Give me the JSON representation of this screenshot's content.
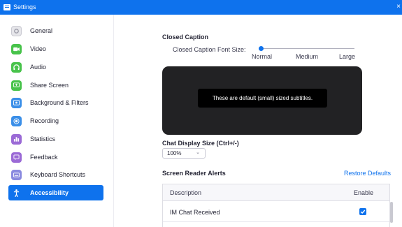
{
  "window": {
    "title": "Settings",
    "close": "×"
  },
  "sidebar": {
    "items": [
      {
        "label": "General",
        "icon": "gear-icon",
        "color": "#e6e6ea"
      },
      {
        "label": "Video",
        "icon": "video-icon",
        "color": "#48c34b"
      },
      {
        "label": "Audio",
        "icon": "headphones-icon",
        "color": "#48c34b"
      },
      {
        "label": "Share Screen",
        "icon": "share-screen-icon",
        "color": "#48c34b"
      },
      {
        "label": "Background & Filters",
        "icon": "background-icon",
        "color": "#3b8fe8"
      },
      {
        "label": "Recording",
        "icon": "record-icon",
        "color": "#3b8fe8"
      },
      {
        "label": "Statistics",
        "icon": "statistics-icon",
        "color": "#9b6ad6"
      },
      {
        "label": "Feedback",
        "icon": "feedback-icon",
        "color": "#9b6ad6"
      },
      {
        "label": "Keyboard Shortcuts",
        "icon": "keyboard-icon",
        "color": "#8a8adf"
      },
      {
        "label": "Accessibility",
        "icon": "accessibility-icon",
        "color": "#0e72ed",
        "active": true
      }
    ]
  },
  "closed_caption": {
    "heading": "Closed Caption",
    "font_size_label": "Closed Caption Font Size:",
    "options": [
      "Normal",
      "Medium",
      "Large"
    ],
    "selected": "Normal",
    "preview_text": "These are default (small) sized subtitles."
  },
  "chat_display": {
    "heading": "Chat Display Size (Ctrl+/-)",
    "value": "100%"
  },
  "screen_reader": {
    "heading": "Screen Reader Alerts",
    "restore_link": "Restore Defaults",
    "columns": [
      "Description",
      "Enable"
    ],
    "rows": [
      {
        "description": "IM Chat Received",
        "enabled": true
      }
    ]
  }
}
